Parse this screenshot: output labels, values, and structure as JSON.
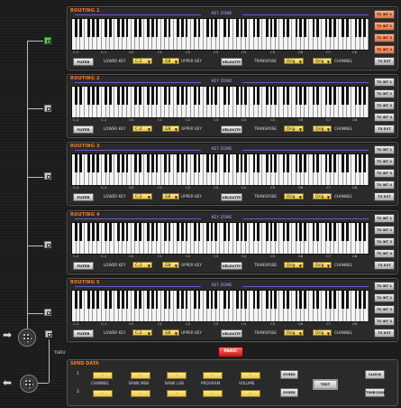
{
  "routings": [
    {
      "title": "ROUTING 1",
      "zone": "KEY ZONE",
      "lower": "C-2",
      "upper": "G8",
      "transpose": "Orig",
      "channel": "Orig",
      "active": true,
      "txActive": [
        true,
        true,
        true,
        true
      ]
    },
    {
      "title": "ROUTING 2",
      "zone": "KEY ZONE",
      "lower": "C-2",
      "upper": "G8",
      "transpose": "Orig",
      "channel": "Orig",
      "active": false,
      "txActive": [
        false,
        false,
        false,
        false
      ]
    },
    {
      "title": "ROUTING 3",
      "zone": "KEY ZONE",
      "lower": "C-2",
      "upper": "G8",
      "transpose": "Orig",
      "channel": "Orig",
      "active": false,
      "txActive": [
        false,
        false,
        false,
        false
      ]
    },
    {
      "title": "ROUTING 4",
      "zone": "KEY ZONE",
      "lower": "C-2",
      "upper": "G8",
      "transpose": "Orig",
      "channel": "Orig",
      "active": false,
      "txActive": [
        false,
        false,
        false,
        false
      ]
    },
    {
      "title": "ROUTING 5",
      "zone": "KEY ZONE",
      "lower": "C-2",
      "upper": "G8",
      "transpose": "Orig",
      "channel": "Orig",
      "active": false,
      "txActive": [
        false,
        false,
        false,
        false
      ]
    }
  ],
  "labels": {
    "filter": "FILTER",
    "lower_key": "LOWER KEY",
    "upper_key": "UPPER KEY",
    "velocity": "VELOCITY",
    "transpose": "TRANSPOSE",
    "channel": "CHANNEL",
    "tx": [
      "TX INT 1",
      "TX INT 2",
      "TX INT 3",
      "TX INT 4",
      "TX EXT"
    ]
  },
  "octaves": [
    "C-2",
    "C-1",
    "C0",
    "C1",
    "C2",
    "C3",
    "C4",
    "C5",
    "C6",
    "C7",
    "C8"
  ],
  "panic": "PANIC",
  "thru": "THRU",
  "send": {
    "title": "SEND DATA",
    "row1": "1",
    "row2": "2",
    "columns": [
      "CHANNEL",
      "BANK MSB",
      "BANK LSB",
      "PROGRAM",
      "VOLUME"
    ],
    "dash": "-",
    "sysex": "SYSEX",
    "test": "TEST",
    "clock": "CLOCK",
    "timecode": "TIMECODE"
  }
}
